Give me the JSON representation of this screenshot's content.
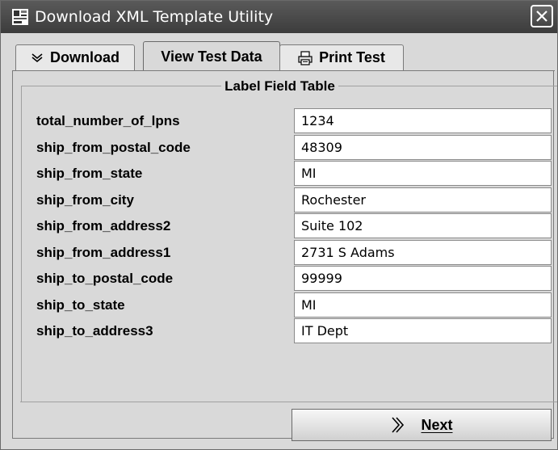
{
  "window": {
    "title": "Download XML Template Utility",
    "titlebar_color": "#4a4a4a"
  },
  "tabs": [
    {
      "label": "Download",
      "icon": "chevron-down-icon",
      "selected": false
    },
    {
      "label": "View Test Data",
      "icon": null,
      "selected": true
    },
    {
      "label": "Print Test",
      "icon": "printer-icon",
      "selected": false
    }
  ],
  "group": {
    "title": "Label Field Table",
    "fields": [
      {
        "name": "total_number_of_lpns",
        "value": "1234"
      },
      {
        "name": "ship_from_postal_code",
        "value": "48309"
      },
      {
        "name": "ship_from_state",
        "value": "MI"
      },
      {
        "name": "ship_from_city",
        "value": "Rochester"
      },
      {
        "name": "ship_from_address2",
        "value": "Suite 102"
      },
      {
        "name": "ship_from_address1",
        "value": "2731 S Adams"
      },
      {
        "name": "ship_to_postal_code",
        "value": "99999"
      },
      {
        "name": "ship_to_state",
        "value": "MI"
      },
      {
        "name": "ship_to_address3",
        "value": "IT Dept"
      }
    ]
  },
  "footer": {
    "next_label": "Next",
    "next_icon": "double-chevron-right-icon"
  }
}
